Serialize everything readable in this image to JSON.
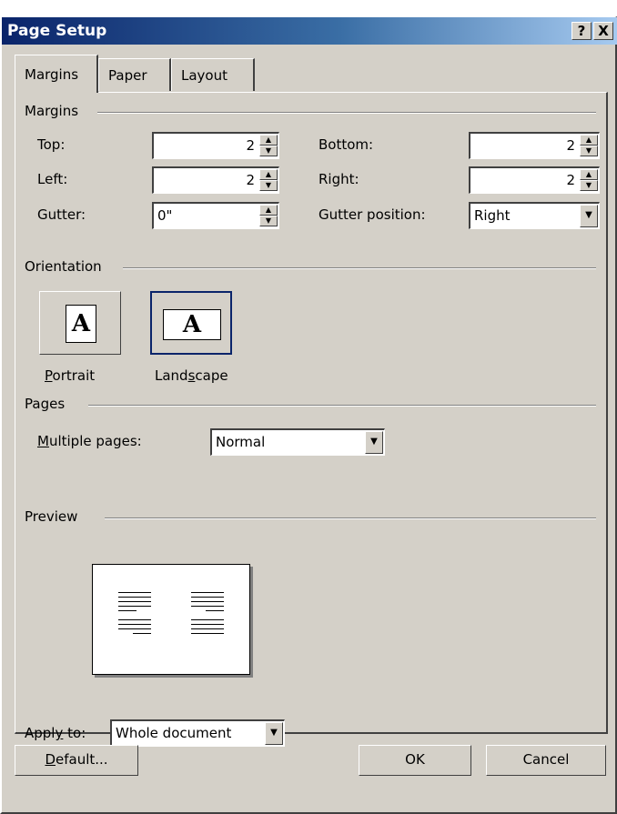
{
  "window": {
    "title": "Page Setup",
    "help_label": "?",
    "close_label": "X"
  },
  "tabs": [
    {
      "label": "Margins"
    },
    {
      "label": "Paper"
    },
    {
      "label": "Layout"
    }
  ],
  "margins_group": {
    "label": "Margins",
    "top": {
      "label": "Top:",
      "value": "2"
    },
    "bottom": {
      "label": "Bottom:",
      "value": "2"
    },
    "left": {
      "label": "Left:",
      "value": "2"
    },
    "right": {
      "label": "Right:",
      "value": "2"
    },
    "gutter": {
      "label": "Gutter:",
      "value": "0\""
    },
    "gutter_position": {
      "label": "Gutter position:",
      "value": "Right"
    }
  },
  "orientation_group": {
    "label": "Orientation",
    "portrait": {
      "label": "Portrait",
      "glyph": "A"
    },
    "landscape": {
      "label": "Landscape",
      "glyph": "A"
    },
    "selected": "Landscape"
  },
  "pages_group": {
    "label": "Pages",
    "multiple_pages": {
      "label": "Multiple pages:",
      "value": "Normal"
    }
  },
  "preview_group": {
    "label": "Preview"
  },
  "apply_to": {
    "label": "Apply to:",
    "value": "Whole document"
  },
  "buttons": {
    "default": "Default...",
    "ok": "OK",
    "cancel": "Cancel"
  }
}
